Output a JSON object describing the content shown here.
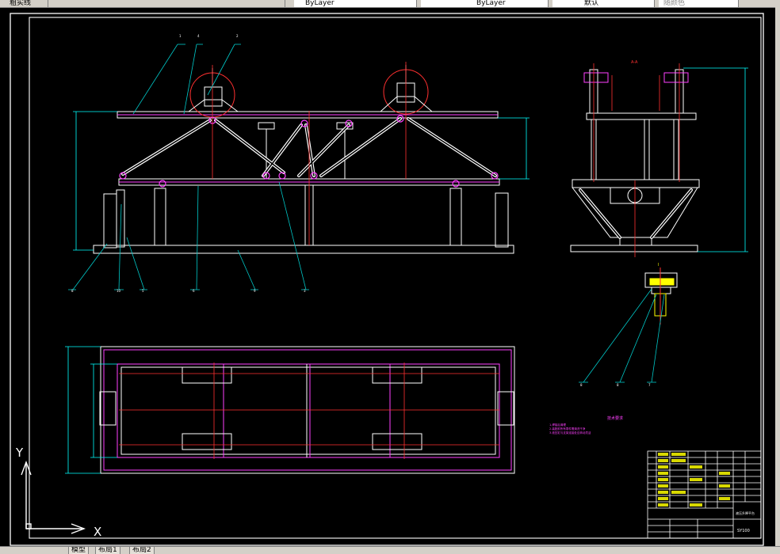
{
  "toolbar": {
    "layer_text": "粗实线",
    "field_1": "ByLayer",
    "field_2": "ByLayer",
    "field_3": "默认",
    "field_4": "随颜色"
  },
  "view_labels": {
    "side_view": "A-A",
    "detail": "I",
    "tech_title": "技术要求"
  },
  "tech_notes": [
    "1.焊接后清理",
    "2.装配前所有零件需清洗干净",
    "3.液压缸与支架连接处应转动灵活"
  ],
  "title_block": {
    "drawing_name": "液压升降平台",
    "code": "SY100"
  },
  "ucs": {
    "x_label": "X",
    "y_label": "Y"
  },
  "tabs": [
    {
      "label": "模型"
    },
    {
      "label": "布局1"
    },
    {
      "label": "布局2"
    }
  ],
  "colors": {
    "background": "#000000",
    "outline": "#ffffff",
    "leader": "#00c8c8",
    "dimension": "#00ffff",
    "center": "#ff3030",
    "part": "#ff40ff",
    "highlight": "#ffff00"
  }
}
